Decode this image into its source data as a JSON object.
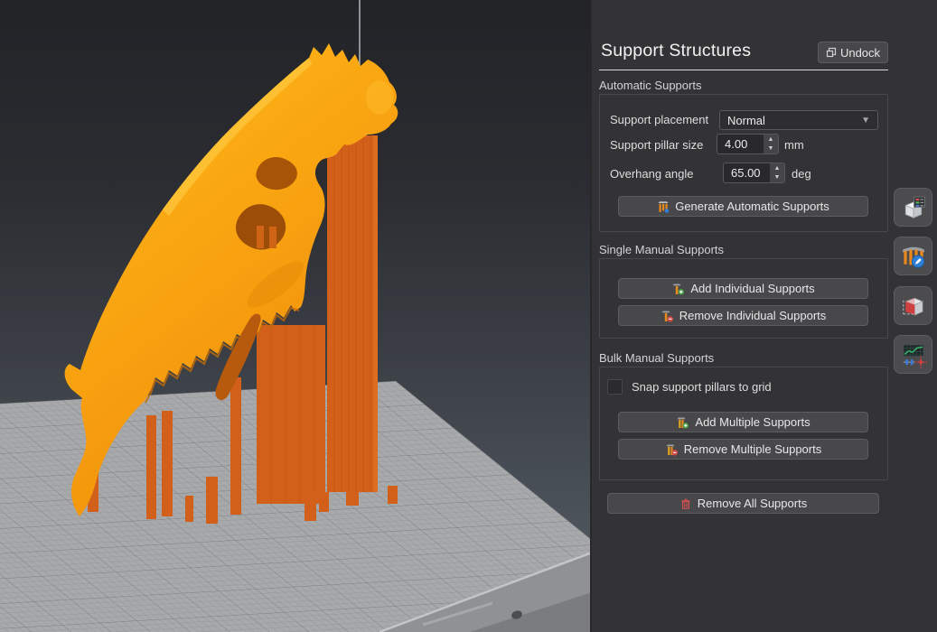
{
  "panel": {
    "title": "Support Structures",
    "undock_label": "Undock",
    "automatic": {
      "heading": "Automatic Supports",
      "placement_label": "Support placement",
      "placement_value": "Normal",
      "pillar_size_label": "Support pillar size",
      "pillar_size_value": "4.00",
      "pillar_size_unit": "mm",
      "overhang_label": "Overhang angle",
      "overhang_value": "65.00",
      "overhang_unit": "deg",
      "generate_button": "Generate Automatic Supports"
    },
    "single": {
      "heading": "Single Manual Supports",
      "add_button": "Add Individual Supports",
      "remove_button": "Remove Individual Supports"
    },
    "bulk": {
      "heading": "Bulk Manual Supports",
      "snap_label": "Snap support pillars to grid",
      "snap_checked": false,
      "add_button": "Add Multiple Supports",
      "remove_button": "Remove Multiple Supports"
    },
    "remove_all_button": "Remove All Supports"
  },
  "toolbar": {
    "buttons": [
      {
        "icon": "model-properties-icon"
      },
      {
        "icon": "edit-supports-icon"
      },
      {
        "icon": "hollow-model-icon"
      },
      {
        "icon": "print-settings-icon"
      }
    ]
  },
  "viewport": {
    "scene": "orange skull model with support pillars on build plate",
    "colors": {
      "model": "#f79d10",
      "supports": "#d2601a",
      "plate": "#a7a9ab",
      "background_top": "#222327",
      "background_bottom": "#535a62",
      "badge_blue": "#2f7fd6"
    }
  }
}
